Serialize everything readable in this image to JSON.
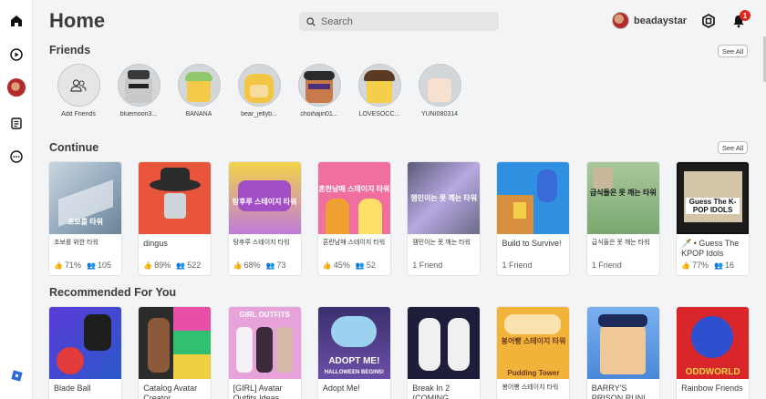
{
  "header": {
    "title": "Home",
    "search_placeholder": "Search",
    "username": "beadaystar",
    "notification_count": "1"
  },
  "nav": {
    "items": [
      "home-icon",
      "discover-icon",
      "avatar-icon",
      "feed-icon",
      "more-icon",
      "roblox-logo-icon"
    ]
  },
  "friends": {
    "title": "Friends",
    "see_all": "See All",
    "add_label": "Add Friends",
    "list": [
      {
        "name": "bluemoon3...",
        "color": "#3a3a3a"
      },
      {
        "name": "BANANA",
        "color": "#8fc86a"
      },
      {
        "name": "bear_jellyb...",
        "color": "#f2c542"
      },
      {
        "name": "choihajin01...",
        "color": "#c97a4a"
      },
      {
        "name": "LOVESOCC...",
        "color": "#5a3a22"
      },
      {
        "name": "YUNI080314",
        "color": "#f4a6d3"
      }
    ]
  },
  "continue": {
    "title": "Continue",
    "see_all": "See All",
    "games": [
      {
        "name": "초보를 위한 타워",
        "rating": "71%",
        "players": "105",
        "bg": "#9fb3c3",
        "accent": "#e9eef2"
      },
      {
        "name": "dingus",
        "rating": "89%",
        "players": "522",
        "bg": "#e8553a",
        "accent": "#2b2b2b"
      },
      {
        "name": "탕후루 스테이지 타워",
        "rating": "68%",
        "players": "73",
        "bg": "#c07ad8",
        "accent": "#f3d34a"
      },
      {
        "name": "혼란남매 스테이지 타워",
        "rating": "45%",
        "players": "52",
        "bg": "#f06fa0",
        "accent": "#ffe066"
      },
      {
        "name": "잼민이는 못 깨는 타워",
        "friends": "1 Friend",
        "bg": "#8a8aa8",
        "accent": "#d7c4f0"
      },
      {
        "name": "Build to Survive!",
        "friends": "1 Friend",
        "bg": "#2f8fe0",
        "accent": "#d89040"
      },
      {
        "name": "급식들은 못 깨는 타워",
        "friends": "1 Friend",
        "bg": "#7aa870",
        "accent": "#c9b79c"
      },
      {
        "name": "🗡️ • Guess The KPOP Idols",
        "rating": "77%",
        "players": "16",
        "bg": "#1c1c1c",
        "accent": "#e03030"
      }
    ]
  },
  "recommended": {
    "title": "Recommended For You",
    "games": [
      {
        "name": "Blade Ball",
        "bg": "#2a58c9",
        "accent": "#e33b3b"
      },
      {
        "name": "Catalog Avatar Creator",
        "bg": "#2c2c2c",
        "accent": "#e84fa8"
      },
      {
        "name": "[GIRL] Avatar Outfits Ideas",
        "bg": "#e7a2d9",
        "accent": "#ffffff"
      },
      {
        "name": "Adopt Me!",
        "bg": "#3b2f6e",
        "accent": "#9bd2f0"
      },
      {
        "name": "Break In 2 (COMING...",
        "bg": "#1e1e3a",
        "accent": "#f0f0f0"
      },
      {
        "name": "봉어빵 스테이지 타워",
        "bg": "#f2b33b",
        "accent": "#a8602a"
      },
      {
        "name": "BARRY'S PRISON RUN!...",
        "bg": "#4a88d8",
        "accent": "#f0d060"
      },
      {
        "name": "Rainbow Friends",
        "bg": "#d8262a",
        "accent": "#2c50d0"
      }
    ]
  },
  "thumb_captions": {
    "c0": "초보를 타워",
    "c2": "탕후루 스테이지 타워",
    "c3": "혼란남매 스테이지 타워",
    "c4": "잼민이는 못 깨는 타워",
    "c6": "급식들은 못 깨는 타워",
    "c7": "Guess The K-POP IDOLS",
    "r2": "GIRL OUTFITS",
    "r3": "ADOPT ME!",
    "r3b": "HALLOWEEN BEGINS!",
    "r5": "봉어빵 스테이지 타워",
    "r5b": "Pudding Tower",
    "r7": "ODDWORLD"
  }
}
